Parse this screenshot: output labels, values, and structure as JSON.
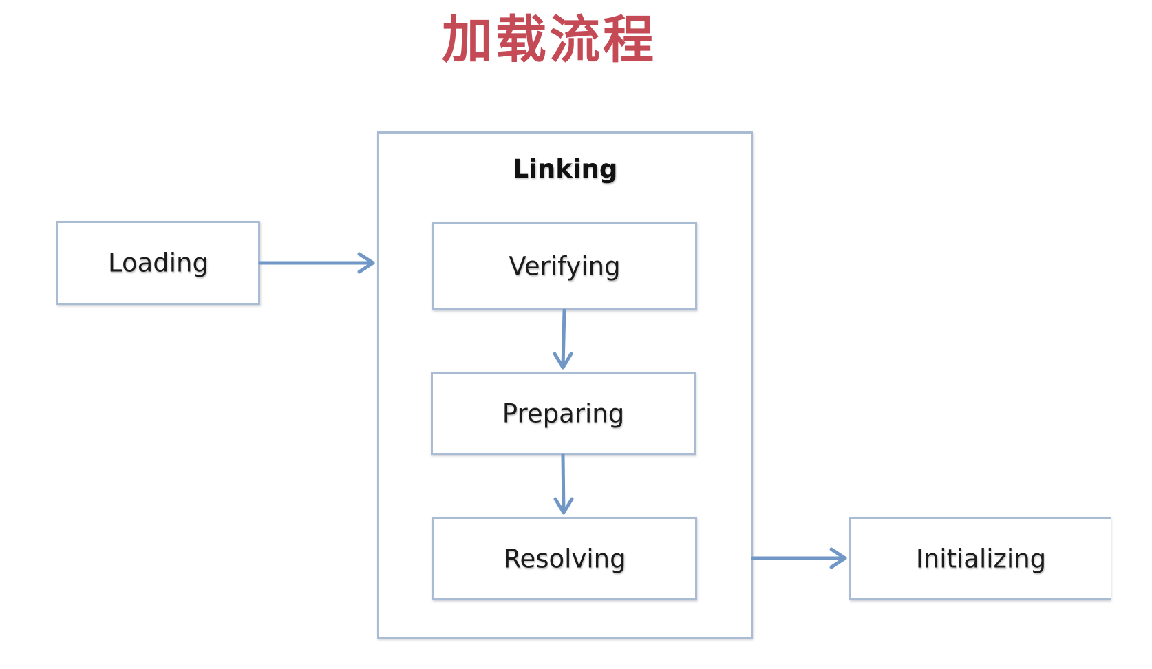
{
  "title": "加载流程",
  "nodes": {
    "loading": "Loading",
    "linking": "Linking",
    "verifying": "Verifying",
    "preparing": "Preparing",
    "resolving": "Resolving",
    "initializing": "Initializing"
  },
  "colors": {
    "title": "#c44a55",
    "box_border": "#a9bcd4",
    "arrow": "#7097c6"
  }
}
